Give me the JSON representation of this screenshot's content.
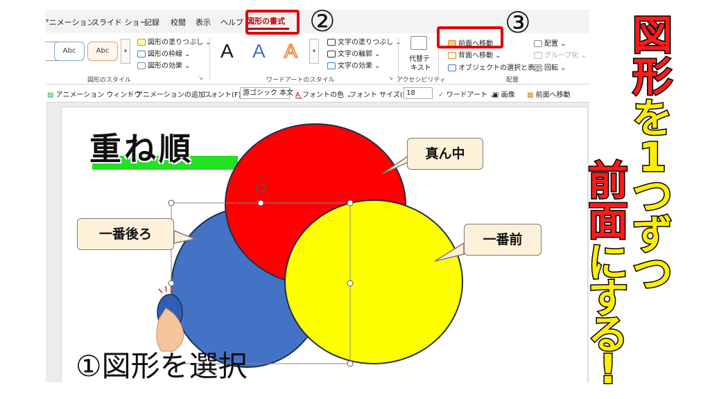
{
  "tabs": [
    "アニメーション",
    "スライド ショー",
    "記録",
    "校閲",
    "表示",
    "ヘルプ"
  ],
  "active_tab": "図形の書式",
  "ribbon": {
    "shape_styles": {
      "style_box_1": "Abc",
      "style_box_2": "Abc",
      "fill": "図形の塗りつぶし ⌄",
      "outline": "図形の枠線 ⌄",
      "effects": "図形の効果 ⌄",
      "label": "図形のスタイル"
    },
    "wordart": {
      "letter": "A",
      "text_fill": "文字の塗りつぶし ⌄",
      "text_outline": "文字の輪郭 ⌄",
      "text_effects": "文字の効果 ⌄",
      "label": "ワードアートのスタイル"
    },
    "accessibility": {
      "alt_text_1": "代替テ",
      "alt_text_2": "キスト",
      "label": "アクセシビリティ"
    },
    "arrange": {
      "bring_forward": "前面へ移動",
      "send_backward": "背面へ移動 ⌄",
      "selection_pane": "オブジェクトの選択と表示",
      "align": "配置 ⌄",
      "group": "グループ化 ⌄",
      "rotate": "回転 ⌄",
      "label": "配置"
    }
  },
  "toolbar2": {
    "animation_pane": "アニメーション ウィンドウ",
    "add_animation": "アニメーションの追加 ⌄",
    "font_label": "フォント(F):",
    "font_value": "游ゴシック 本文",
    "font_color": "フォントの色 ⌄",
    "font_size_label": "フォント サイズ(F):",
    "font_size_value": "18",
    "wordart": "ワードアート ⌄",
    "image": "画像",
    "bring_forward": "前面へ移動"
  },
  "slide": {
    "title": "重ね順",
    "callout_middle": "真ん中",
    "callout_back": "一番後ろ",
    "callout_front": "一番前",
    "caption": "①図形を選択"
  },
  "steps": {
    "step2": "②",
    "step3": "③"
  },
  "side": {
    "line1": [
      "図",
      "形"
    ],
    "line1b": [
      "を",
      "1",
      "つ",
      "ず",
      "つ"
    ],
    "line2": [
      "前",
      "面"
    ],
    "line2b": [
      "に",
      "す",
      "る",
      "!"
    ]
  },
  "colors": {
    "red_circle": "#ff0000",
    "blue_circle": "#4472c4",
    "yellow_circle": "#ffff00",
    "highlight_box": "#e00000",
    "title_bar": "#22e022"
  }
}
